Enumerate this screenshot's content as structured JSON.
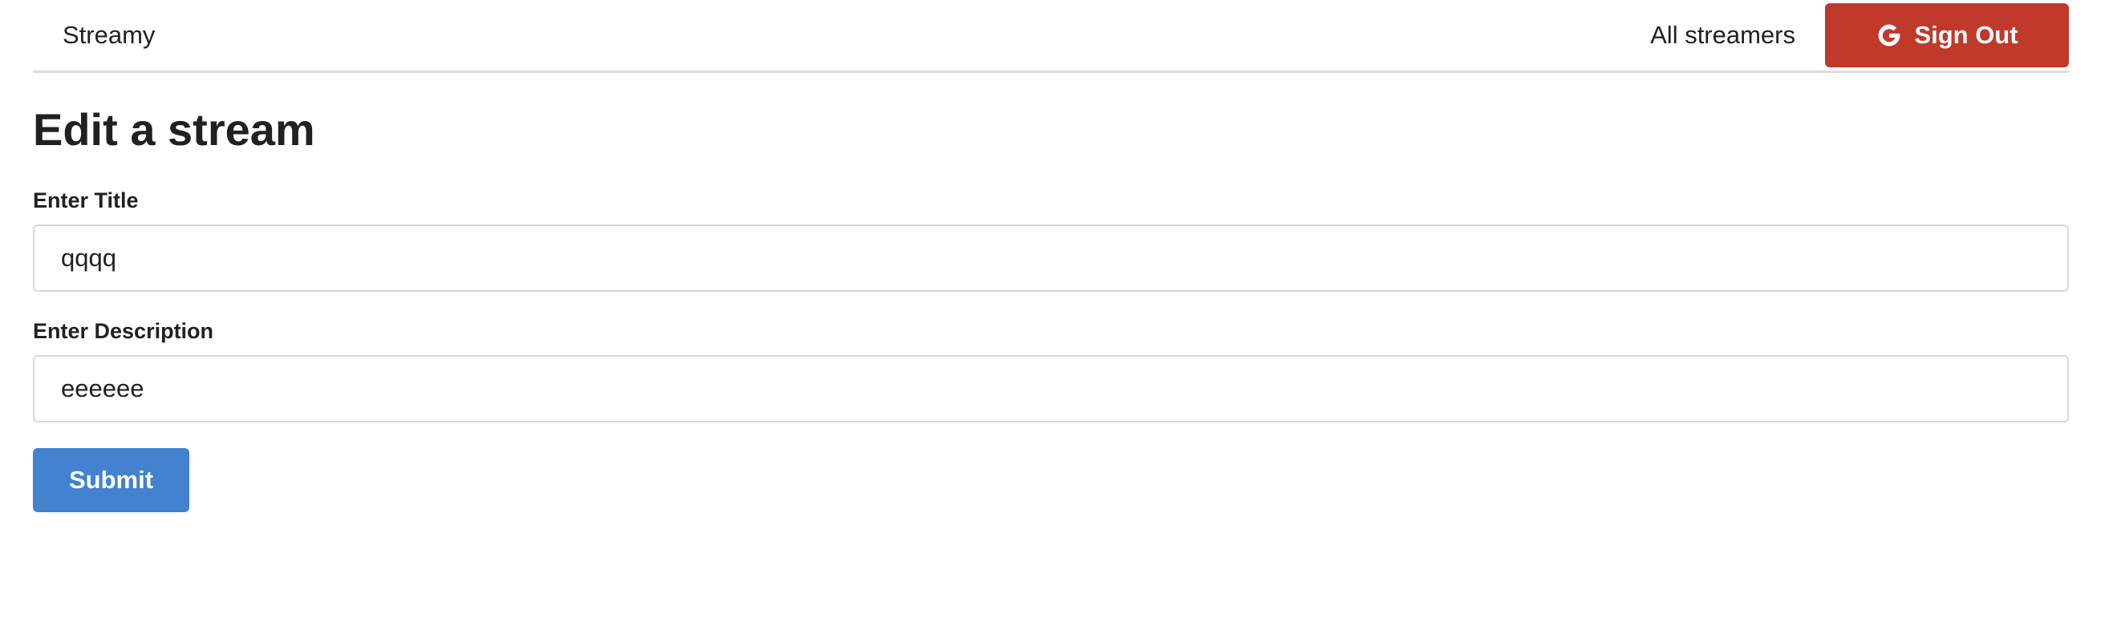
{
  "navbar": {
    "brand": "Streamy",
    "all_streamers_link": "All streamers",
    "signout_label": "Sign Out",
    "signout_icon": "google-icon",
    "signout_color": "#c0392b"
  },
  "main": {
    "title": "Edit a stream",
    "title_field": {
      "label": "Enter Title",
      "value": "qqqq"
    },
    "description_field": {
      "label": "Enter Description",
      "value": "eeeeee"
    },
    "submit_label": "Submit",
    "submit_color": "#4282cf"
  }
}
